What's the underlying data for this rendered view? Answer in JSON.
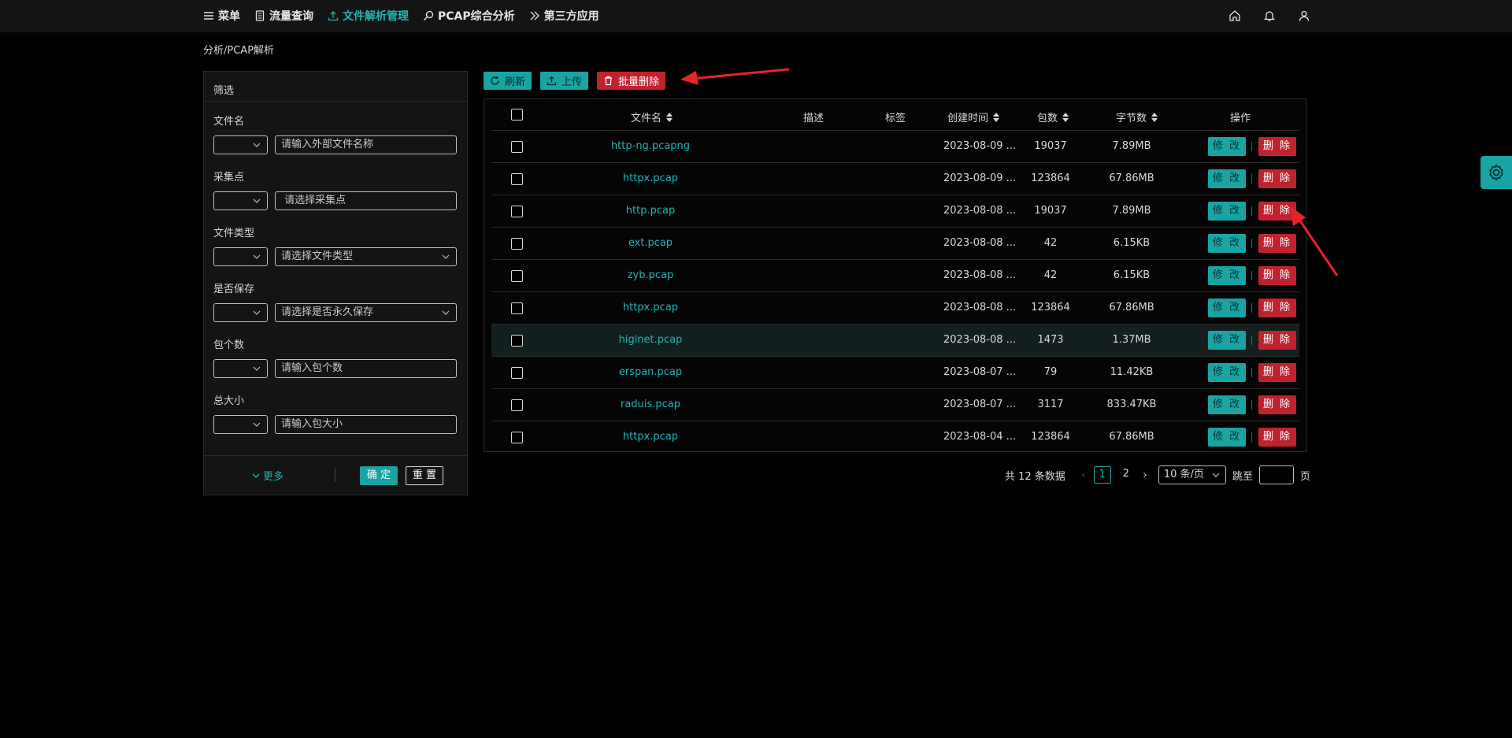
{
  "nav": {
    "items": [
      {
        "label": "菜单",
        "icon": "menu-icon"
      },
      {
        "label": "流量查询",
        "icon": "document-icon"
      },
      {
        "label": "文件解析管理",
        "icon": "upload-icon"
      },
      {
        "label": "PCAP综合分析",
        "icon": "search-icon"
      },
      {
        "label": "第三方应用",
        "icon": "double-chevron-icon"
      }
    ],
    "active_index": 2,
    "right_icons": [
      "home-icon",
      "bell-icon",
      "user-icon"
    ]
  },
  "breadcrumb": "分析/PCAP解析",
  "filter": {
    "title": "筛选",
    "fields": [
      {
        "label": "文件名",
        "placeholder": "请输入外部文件名称",
        "has_dropdown": false
      },
      {
        "label": "采集点",
        "placeholder": " 请选择采集点",
        "has_dropdown": false
      },
      {
        "label": "文件类型",
        "placeholder": "请选择文件类型",
        "has_dropdown": true
      },
      {
        "label": "是否保存",
        "placeholder": "请选择是否永久保存",
        "has_dropdown": true
      },
      {
        "label": "包个数",
        "placeholder": "请输入包个数",
        "has_dropdown": false
      },
      {
        "label": "总大小",
        "placeholder": "请输入包大小",
        "has_dropdown": false
      }
    ],
    "more_label": "更多",
    "confirm_label": "确 定",
    "reset_label": "重 置"
  },
  "toolbar": {
    "refresh_label": "刷新",
    "upload_label": "上传",
    "batch_delete_label": "批量删除"
  },
  "table": {
    "columns": {
      "filename": "文件名",
      "desc": "描述",
      "tag": "标签",
      "created": "创建时间",
      "packets": "包数",
      "bytes": "字节数",
      "ops": "操作"
    },
    "edit_label": "修 改",
    "delete_label": "删 除",
    "rows": [
      {
        "filename": "http-ng.pcapng",
        "desc": "",
        "tag": "",
        "created": "2023-08-09 ...",
        "packets": "19037",
        "bytes": "7.89MB"
      },
      {
        "filename": "httpx.pcap",
        "desc": "",
        "tag": "",
        "created": "2023-08-09 ...",
        "packets": "123864",
        "bytes": "67.86MB"
      },
      {
        "filename": "http.pcap",
        "desc": "",
        "tag": "",
        "created": "2023-08-08 ...",
        "packets": "19037",
        "bytes": "7.89MB"
      },
      {
        "filename": "ext.pcap",
        "desc": "",
        "tag": "",
        "created": "2023-08-08 ...",
        "packets": "42",
        "bytes": "6.15KB"
      },
      {
        "filename": "zyb.pcap",
        "desc": "",
        "tag": "",
        "created": "2023-08-08 ...",
        "packets": "42",
        "bytes": "6.15KB"
      },
      {
        "filename": "httpx.pcap",
        "desc": "",
        "tag": "",
        "created": "2023-08-08 ...",
        "packets": "123864",
        "bytes": "67.86MB"
      },
      {
        "filename": "higinet.pcap",
        "desc": "",
        "tag": "",
        "created": "2023-08-08 ...",
        "packets": "1473",
        "bytes": "1.37MB"
      },
      {
        "filename": "erspan.pcap",
        "desc": "",
        "tag": "",
        "created": "2023-08-07 ...",
        "packets": "79",
        "bytes": "11.42KB"
      },
      {
        "filename": "raduis.pcap",
        "desc": "",
        "tag": "",
        "created": "2023-08-07 ...",
        "packets": "3117",
        "bytes": "833.47KB"
      },
      {
        "filename": "httpx.pcap",
        "desc": "",
        "tag": "",
        "created": "2023-08-04 ...",
        "packets": "123864",
        "bytes": "67.86MB"
      }
    ],
    "highlighted_row": 6
  },
  "pagination": {
    "total_text": "共 12 条数据",
    "pages": [
      "1",
      "2"
    ],
    "current_page": "1",
    "page_size": "10 条/页",
    "jump_label": "跳至",
    "page_suffix": "页"
  },
  "colors": {
    "accent": "#1aa3a3",
    "danger": "#c0232f",
    "annotation": "#e8232a"
  }
}
